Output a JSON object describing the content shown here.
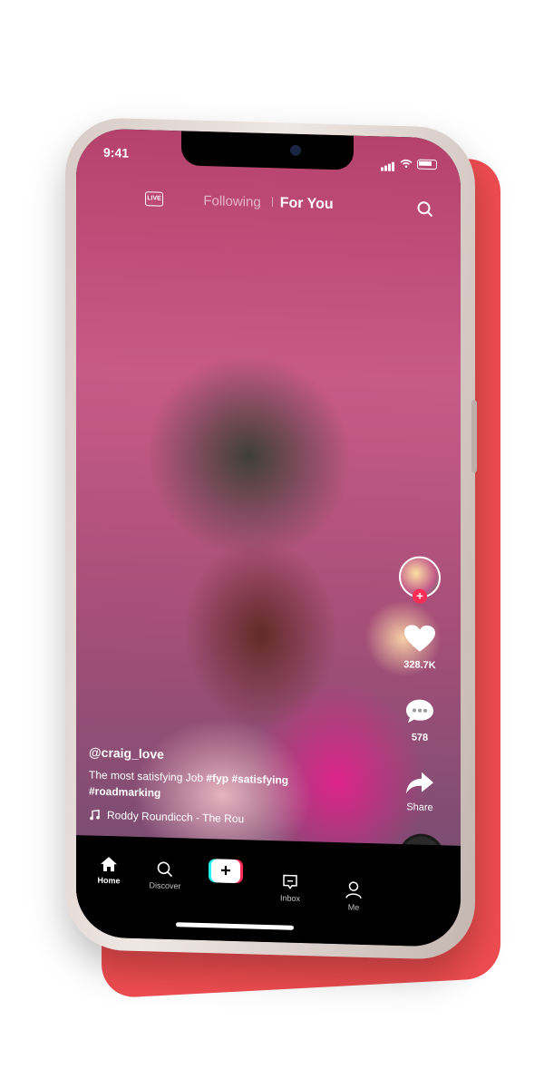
{
  "status_bar": {
    "time": "9:41"
  },
  "top_bar": {
    "live_label": "LIVE",
    "tabs": [
      {
        "label": "Following",
        "active": false
      },
      {
        "label": "For You",
        "active": true
      }
    ]
  },
  "rail": {
    "likes": "328.7K",
    "comments": "578",
    "share_label": "Share"
  },
  "post": {
    "username": "@craig_love",
    "caption": "The most satisfying Job",
    "hashtags": [
      "#fyp",
      "#satisfying",
      "#roadmarking"
    ],
    "music": "Roddy Roundicch - The Rou"
  },
  "nav": {
    "home": "Home",
    "discover": "Discover",
    "inbox": "Inbox",
    "me": "Me",
    "create": "+"
  },
  "colors": {
    "accent_red": "#fe2c55",
    "accent_cyan": "#25f4ee",
    "slab": "#ef4d50",
    "disc_center": "#f6c81a"
  }
}
